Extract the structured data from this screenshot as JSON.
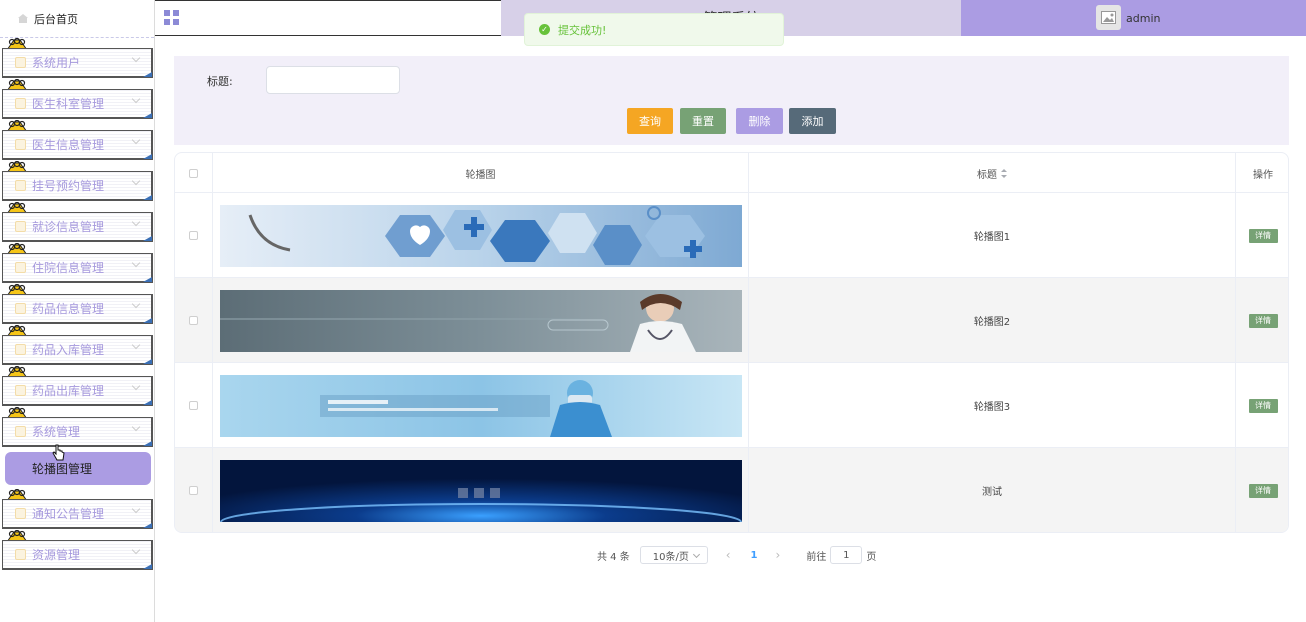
{
  "sidebar": {
    "home_label": "后台首页",
    "items": [
      {
        "label": "系统用户"
      },
      {
        "label": "医生科室管理"
      },
      {
        "label": "医生信息管理"
      },
      {
        "label": "挂号预约管理"
      },
      {
        "label": "就诊信息管理"
      },
      {
        "label": "住院信息管理"
      },
      {
        "label": "药品信息管理"
      },
      {
        "label": "药品入库管理"
      },
      {
        "label": "药品出库管理"
      },
      {
        "label": "系统管理"
      },
      {
        "label": "通知公告管理"
      },
      {
        "label": "资源管理"
      }
    ],
    "active_submenu": "轮播图管理"
  },
  "header": {
    "system_title": "管理系统",
    "username": "admin"
  },
  "toast": {
    "message": "提交成功!",
    "color": "#67c23a"
  },
  "search": {
    "label": "标题:",
    "input_value": "",
    "query_label": "查询",
    "reset_label": "重置",
    "delete_label": "删除",
    "add_label": "添加"
  },
  "table": {
    "headers": {
      "image": "轮播图",
      "title": "标题",
      "action": "操作"
    },
    "rows": [
      {
        "title": "轮播图1",
        "action": "详情",
        "image": "medical-icons-banner"
      },
      {
        "title": "轮播图2",
        "action": "详情",
        "image": "doctor-banner"
      },
      {
        "title": "轮播图3",
        "action": "详情",
        "image": "surgeon-banner"
      },
      {
        "title": "测试",
        "action": "详情",
        "image": "blue-tech-banner"
      }
    ]
  },
  "pagination": {
    "total_text": "共 4 条",
    "page_size": "10条/页",
    "prev": "‹",
    "current_page": "1",
    "next": "›",
    "goto_label": "前往",
    "goto_value": "1",
    "page_unit": "页"
  },
  "colors": {
    "accent": "#ab9ce3",
    "title_bg": "#d7d0e8",
    "panel_bg": "#f2eff9",
    "query": "#f5a623",
    "reset": "#77a275",
    "add": "#566a79"
  }
}
